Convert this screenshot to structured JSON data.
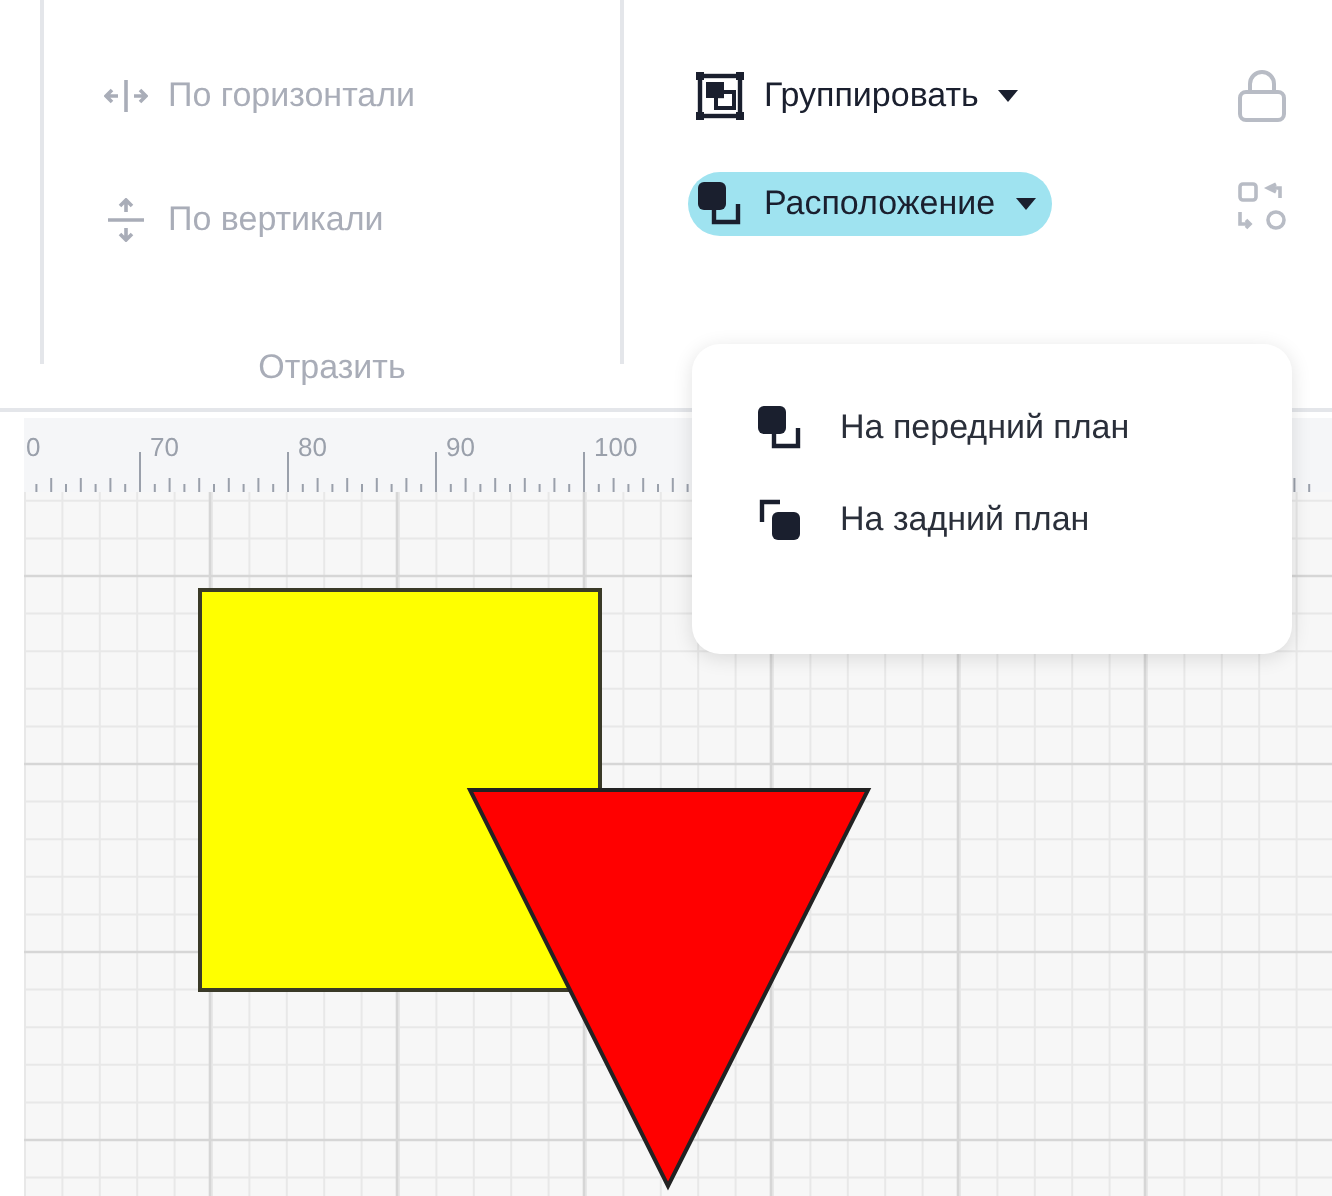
{
  "toolbar": {
    "flip_group": {
      "label": "Отразить",
      "buttons": [
        {
          "kind": "flip-h",
          "label": "По горизонтали",
          "disabled": true
        },
        {
          "kind": "flip-v",
          "label": "По вертикали",
          "disabled": true
        }
      ]
    },
    "arrange_group": {
      "buttons": [
        {
          "kind": "group",
          "label": "Группировать",
          "selected": false
        },
        {
          "kind": "arrange",
          "label": "Расположение",
          "selected": true
        }
      ]
    },
    "side_buttons": [
      {
        "kind": "lock",
        "disabled": true
      },
      {
        "kind": "swap",
        "disabled": true
      }
    ]
  },
  "ruler": {
    "labels": [
      "0",
      "70",
      "80",
      "90",
      "100"
    ]
  },
  "canvas": {
    "shapes": [
      {
        "kind": "square",
        "color": "#ffff00"
      },
      {
        "kind": "triangle",
        "color": "#ff0000"
      }
    ]
  },
  "menu": {
    "items": [
      {
        "kind": "front",
        "label": "На передний план"
      },
      {
        "kind": "back",
        "label": "На задний план"
      }
    ]
  }
}
